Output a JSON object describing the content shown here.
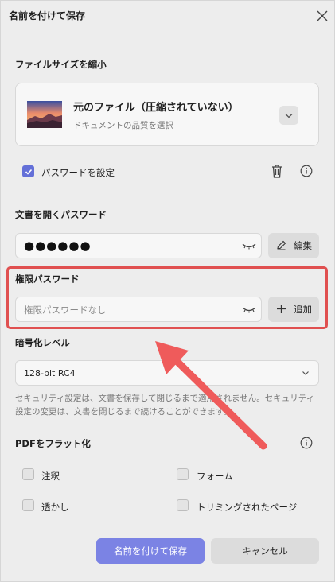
{
  "dialog": {
    "title": "名前を付けて保存"
  },
  "compress": {
    "section_label": "ファイルサイズを縮小",
    "option_title": "元のファイル（圧縮されていない）",
    "option_sub": "ドキュメントの品質を選択"
  },
  "password_toggle": {
    "label": "パスワードを設定",
    "checked": true
  },
  "open_password": {
    "section_label": "文書を開くパスワード",
    "value": "●●●●●●",
    "edit_label": "編集"
  },
  "permission_password": {
    "section_label": "権限パスワード",
    "placeholder": "権限パスワードなし",
    "add_label": "追加"
  },
  "encryption": {
    "section_label": "暗号化レベル",
    "selected": "128-bit RC4",
    "note": "セキュリティ設定は、文書を保存して閉じるまで適用されません。セキュリティ設定の変更は、文書を閉じるまで続けることができます。"
  },
  "flatten": {
    "section_label": "PDFをフラット化",
    "options": [
      {
        "label": "注釈",
        "checked": false
      },
      {
        "label": "フォーム",
        "checked": false
      },
      {
        "label": "透かし",
        "checked": false
      },
      {
        "label": "トリミングされたページ",
        "checked": false
      }
    ]
  },
  "footer": {
    "save_label": "名前を付けて保存",
    "cancel_label": "キャンセル"
  },
  "colors": {
    "accent": "#6470d8",
    "primary_button": "#7b83e4",
    "highlight": "#e05050",
    "arrow": "#ef5b5b"
  }
}
